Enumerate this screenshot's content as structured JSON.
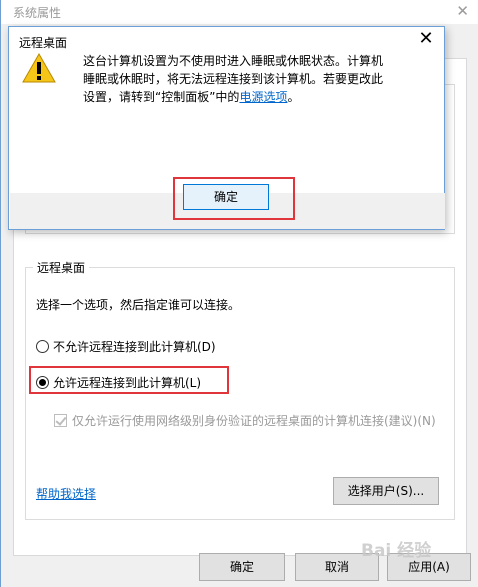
{
  "background_window": {
    "title": "系统属性",
    "group_label": "远程桌面",
    "instruction": "选择一个选项，然后指定谁可以连接。",
    "radio_disallow": "不允许远程连接到此计算机(D)",
    "radio_allow": "允许远程连接到此计算机(L)",
    "checkbox_nla": "仅允许运行使用网络级别身份验证的远程桌面的计算机连接(建议)(N)",
    "help_link": "帮助我选择",
    "select_users_label": "选择用户(S)...",
    "ok_label": "确定",
    "cancel_label": "取消",
    "apply_label": "应用(A)"
  },
  "dialog": {
    "title": "远程桌面",
    "message_part1": "这台计算机设置为不使用时进入睡眠或休眠状态。计算机睡眠或休眠时，将无法远程连接到该计算机。若要更改此设置，请转到“控制面板”中的",
    "power_link": "电源选项",
    "message_end": "。",
    "ok_label": "确定"
  },
  "watermark": "Bai 经验",
  "colors": {
    "highlight": "#e0353b",
    "link": "#0066cc",
    "accent": "#0078d7"
  }
}
